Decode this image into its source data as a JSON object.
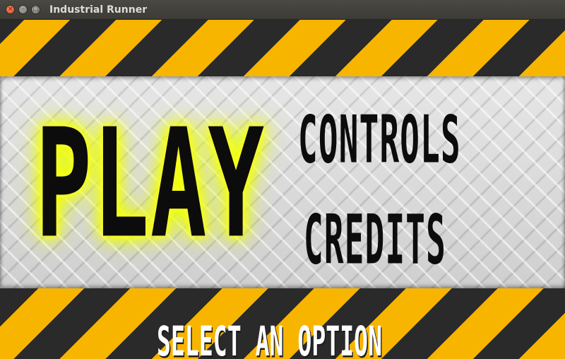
{
  "window": {
    "title": "Industrial Runner",
    "close_glyph": "×",
    "minimize_glyph": "–",
    "maximize_glyph": "□"
  },
  "menu": {
    "play": "PLAY",
    "controls": "CONTROLS",
    "credits": "CREDITS",
    "prompt": "SELECT AN OPTION"
  },
  "colors": {
    "hazard_yellow": "#f7b500",
    "hazard_black": "#2a2a2a",
    "play_glow": "#f5ff00",
    "text": "#0c0c0c"
  }
}
